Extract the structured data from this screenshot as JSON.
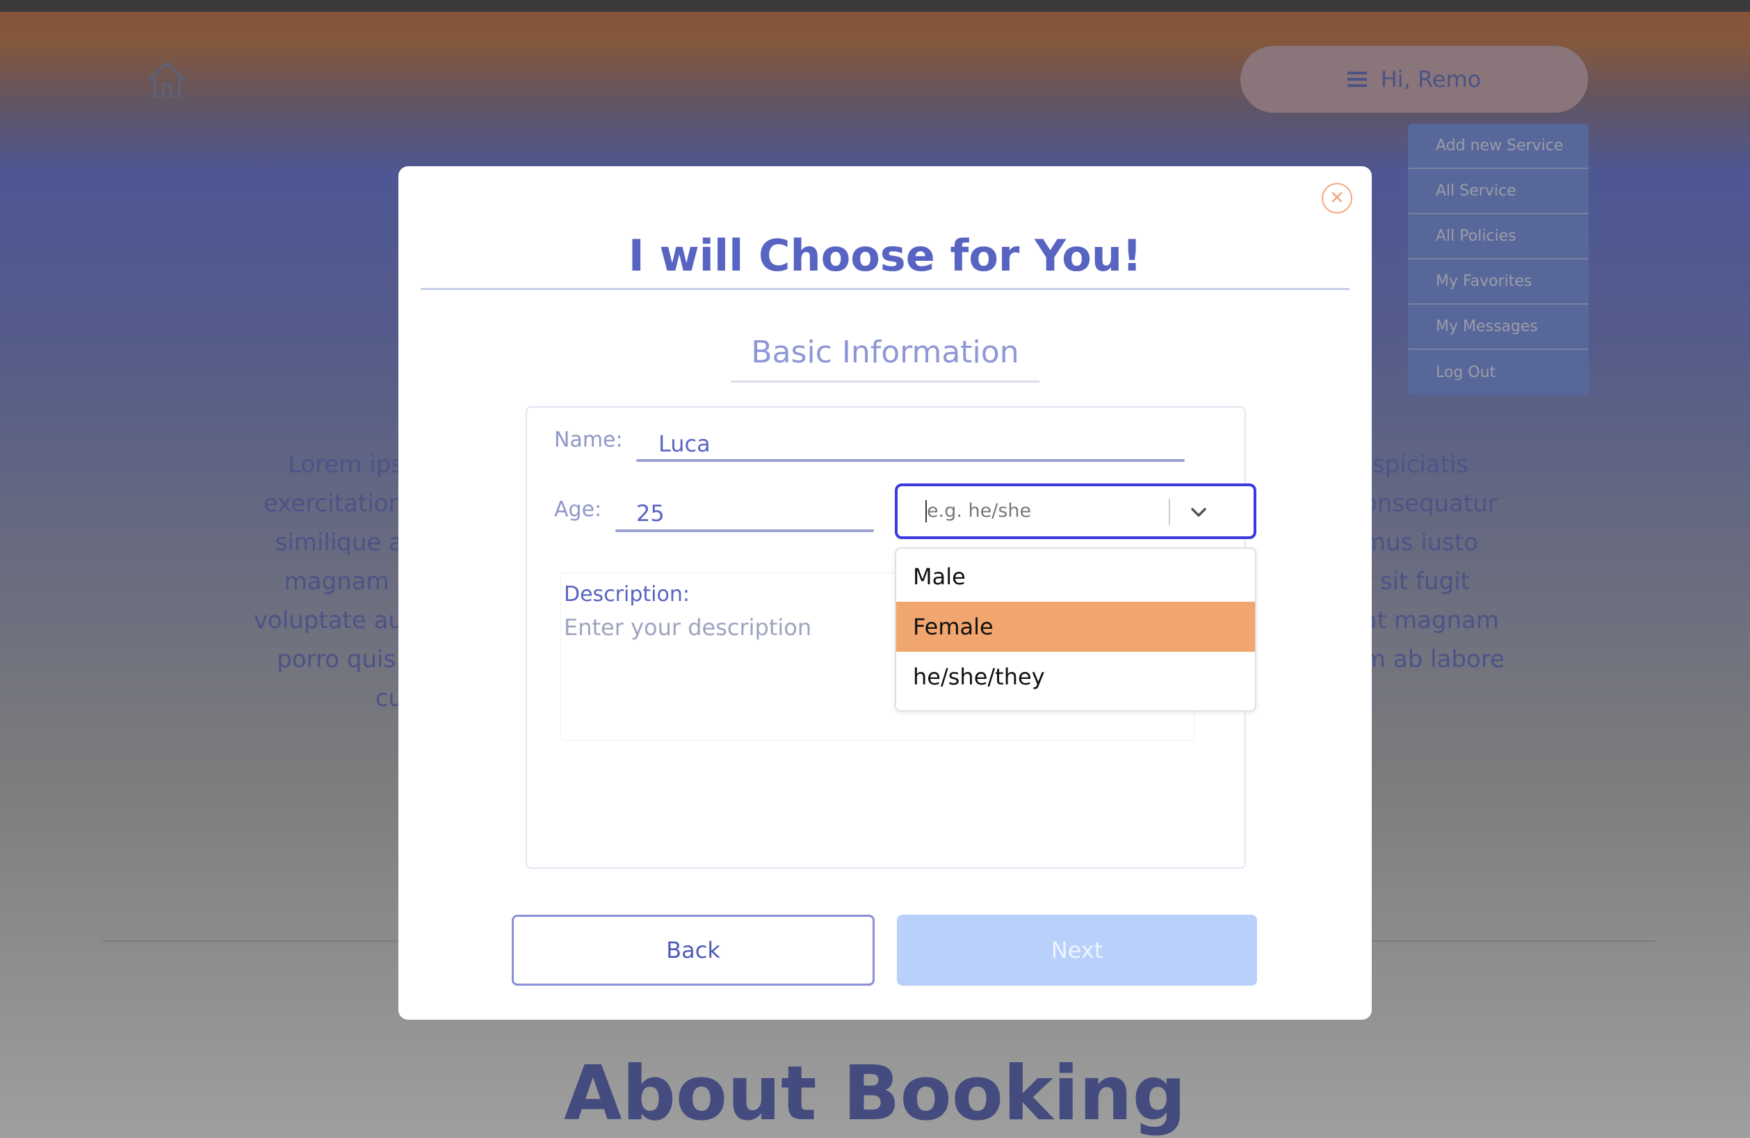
{
  "header": {
    "greeting": "Hi, Remo",
    "menu": [
      "Add new Service",
      "All Service",
      "All Policies",
      "My Favorites",
      "My Messages",
      "Log Out"
    ]
  },
  "background": {
    "left_lines": [
      "Lorem ips",
      "exercitation",
      "similique a",
      "magnam l",
      "voluptate au",
      "porro quis, cu"
    ],
    "right_lines": [
      "rspiciatis",
      "onsequatur",
      "mus iusto",
      "r sit fugit",
      "at magnam",
      "m ab labore"
    ],
    "about_title": "About Booking"
  },
  "modal": {
    "title": "I will Choose for You!",
    "section_title": "Basic Information",
    "name_label": "Name:",
    "name_value": "Luca",
    "age_label": "Age:",
    "age_value": "25",
    "pronoun_placeholder": "e.g. he/she",
    "pronoun_options": [
      "Male",
      "Female",
      "he/she/they"
    ],
    "pronoun_highlighted": "Female",
    "description_label": "Description:",
    "description_placeholder": "Enter your description",
    "back_label": "Back",
    "next_label": "Next"
  }
}
